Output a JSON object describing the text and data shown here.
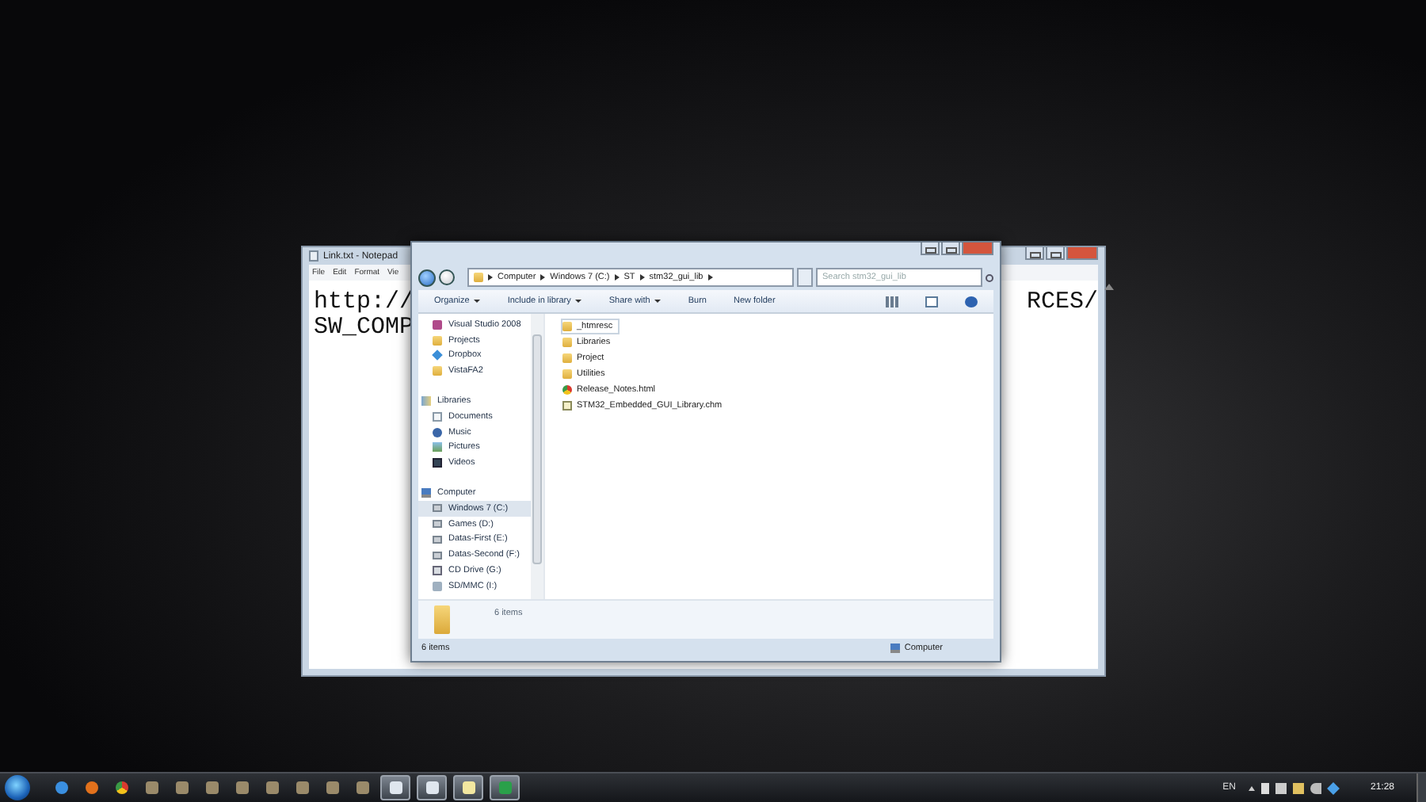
{
  "notepad": {
    "title": "Link.txt - Notepad",
    "menu": [
      "File",
      "Edit",
      "Format",
      "Vie"
    ],
    "text_left": [
      "http://",
      "SW_COMP"
    ],
    "text_right": [
      "RCES/"
    ]
  },
  "explorer": {
    "address": [
      "Computer",
      "Windows 7 (C:)",
      "ST",
      "stm32_gui_lib"
    ],
    "search": {
      "placeholder": "Search stm32_gui_lib"
    },
    "toolbar": [
      {
        "label": "Organize",
        "dropdown": true
      },
      {
        "label": "Include in library",
        "dropdown": true
      },
      {
        "label": "Share with",
        "dropdown": true
      },
      {
        "label": "Burn",
        "dropdown": false
      },
      {
        "label": "New folder",
        "dropdown": false
      }
    ],
    "navigation": {
      "favorites_tail": [
        {
          "label": "Visual Studio 2008",
          "kind": "app",
          "selected": false
        },
        {
          "label": "Projects",
          "kind": "folder",
          "selected": false
        },
        {
          "label": "Dropbox",
          "kind": "dropbox",
          "selected": false
        },
        {
          "label": "VistaFA2",
          "kind": "folder",
          "selected": false
        }
      ],
      "groups": [
        {
          "label": "Libraries",
          "kind": "library",
          "selected": false,
          "children": [
            {
              "label": "Documents",
              "kind": "document",
              "selected": false
            },
            {
              "label": "Music",
              "kind": "music",
              "selected": false
            },
            {
              "label": "Pictures",
              "kind": "picture",
              "selected": false
            },
            {
              "label": "Videos",
              "kind": "video",
              "selected": false
            }
          ]
        },
        {
          "label": "Computer",
          "kind": "computer",
          "selected": false,
          "children": [
            {
              "label": "Windows 7 (C:)",
              "kind": "drive",
              "selected": true
            },
            {
              "label": "Games (D:)",
              "kind": "drive",
              "selected": false
            },
            {
              "label": "Datas-First (E:)",
              "kind": "drive",
              "selected": false
            },
            {
              "label": "Datas-Second (F:)",
              "kind": "drive",
              "selected": false
            },
            {
              "label": "CD Drive (G:)",
              "kind": "cd",
              "selected": false
            },
            {
              "label": "SD/MMC (I:)",
              "kind": "card",
              "selected": false
            }
          ]
        }
      ]
    },
    "files": [
      {
        "name": "_htmresc",
        "kind": "folder",
        "focused": true
      },
      {
        "name": "Libraries",
        "kind": "folder",
        "focused": false
      },
      {
        "name": "Project",
        "kind": "folder",
        "focused": false
      },
      {
        "name": "Utilities",
        "kind": "folder",
        "focused": false
      },
      {
        "name": "Release_Notes.html",
        "kind": "html",
        "focused": false
      },
      {
        "name": "STM32_Embedded_GUI_Library.chm",
        "kind": "chm",
        "focused": false
      }
    ],
    "details": {
      "count": "6 items"
    },
    "status_bar": {
      "count": "6 items",
      "location": "Computer"
    }
  },
  "taskbar": {
    "items": [
      {
        "kind": "ie",
        "active": false
      },
      {
        "kind": "firefox",
        "active": false
      },
      {
        "kind": "chrome",
        "active": false
      },
      {
        "kind": "app",
        "active": false
      },
      {
        "kind": "app",
        "active": false
      },
      {
        "kind": "app",
        "active": false
      },
      {
        "kind": "app",
        "active": false
      },
      {
        "kind": "app",
        "active": false
      },
      {
        "kind": "app",
        "active": false
      },
      {
        "kind": "app",
        "active": false
      },
      {
        "kind": "app",
        "active": false
      },
      {
        "kind": "window",
        "active": true
      },
      {
        "kind": "window",
        "active": true
      },
      {
        "kind": "notepad",
        "active": true
      },
      {
        "kind": "green",
        "active": true
      }
    ],
    "language": "EN",
    "clock": "21:28"
  }
}
